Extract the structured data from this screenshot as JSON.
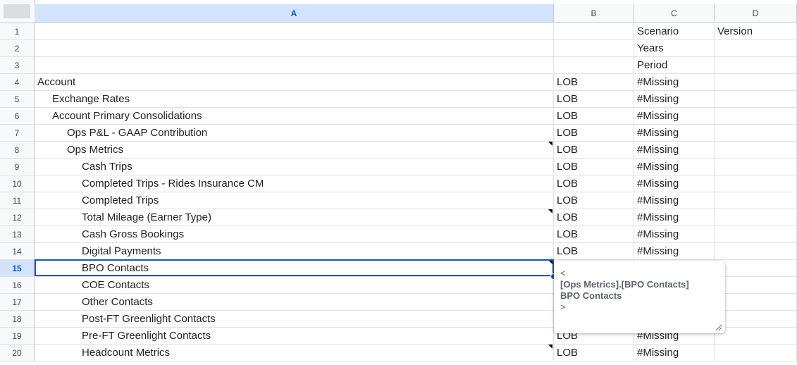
{
  "columns": [
    "A",
    "B",
    "C",
    "D"
  ],
  "active_column": "A",
  "active_row": "15",
  "rows": [
    {
      "num": "1",
      "a": "",
      "b": "",
      "c": "Scenario",
      "d": "Version",
      "indent": 0,
      "note": false
    },
    {
      "num": "2",
      "a": "",
      "b": "",
      "c": "Years",
      "d": "",
      "indent": 0,
      "note": false
    },
    {
      "num": "3",
      "a": "",
      "b": "",
      "c": "Period",
      "d": "",
      "indent": 0,
      "note": false
    },
    {
      "num": "4",
      "a": "Account",
      "b": "LOB",
      "c": "#Missing",
      "d": "",
      "indent": 0,
      "note": false
    },
    {
      "num": "5",
      "a": "Exchange Rates",
      "b": "LOB",
      "c": "#Missing",
      "d": "",
      "indent": 1,
      "note": false
    },
    {
      "num": "6",
      "a": "Account Primary Consolidations",
      "b": "LOB",
      "c": "#Missing",
      "d": "",
      "indent": 1,
      "note": false
    },
    {
      "num": "7",
      "a": "Ops P&L - GAAP Contribution",
      "b": "LOB",
      "c": "#Missing",
      "d": "",
      "indent": 2,
      "note": false
    },
    {
      "num": "8",
      "a": "Ops Metrics",
      "b": "LOB",
      "c": "#Missing",
      "d": "",
      "indent": 2,
      "note": true
    },
    {
      "num": "9",
      "a": "Cash Trips",
      "b": "LOB",
      "c": "#Missing",
      "d": "",
      "indent": 3,
      "note": false
    },
    {
      "num": "10",
      "a": "Completed Trips - Rides Insurance CM",
      "b": "LOB",
      "c": "#Missing",
      "d": "",
      "indent": 3,
      "note": false
    },
    {
      "num": "11",
      "a": "Completed Trips",
      "b": "LOB",
      "c": "#Missing",
      "d": "",
      "indent": 3,
      "note": false
    },
    {
      "num": "12",
      "a": "Total Mileage (Earner Type)",
      "b": "LOB",
      "c": "#Missing",
      "d": "",
      "indent": 3,
      "note": true
    },
    {
      "num": "13",
      "a": "Cash Gross Bookings",
      "b": "LOB",
      "c": "#Missing",
      "d": "",
      "indent": 3,
      "note": false
    },
    {
      "num": "14",
      "a": "Digital Payments",
      "b": "LOB",
      "c": "#Missing",
      "d": "",
      "indent": 3,
      "note": false
    },
    {
      "num": "15",
      "a": "BPO Contacts",
      "b": "",
      "c": "",
      "d": "",
      "indent": 3,
      "note": true
    },
    {
      "num": "16",
      "a": "COE Contacts",
      "b": "",
      "c": "",
      "d": "",
      "indent": 3,
      "note": false
    },
    {
      "num": "17",
      "a": "Other Contacts",
      "b": "",
      "c": "",
      "d": "",
      "indent": 3,
      "note": false
    },
    {
      "num": "18",
      "a": "Post-FT Greenlight Contacts",
      "b": "",
      "c": "",
      "d": "",
      "indent": 3,
      "note": false
    },
    {
      "num": "19",
      "a": "Pre-FT Greenlight Contacts",
      "b": "LOB",
      "c": "#Missing",
      "d": "",
      "indent": 3,
      "note": false
    },
    {
      "num": "20",
      "a": "Headcount Metrics",
      "b": "LOB",
      "c": "#Missing",
      "d": "",
      "indent": 3,
      "note": true
    }
  ],
  "note_popup": {
    "line1": "<",
    "line2": "[Ops Metrics].[BPO Contacts]",
    "line3": "BPO Contacts",
    "line4": ">"
  }
}
